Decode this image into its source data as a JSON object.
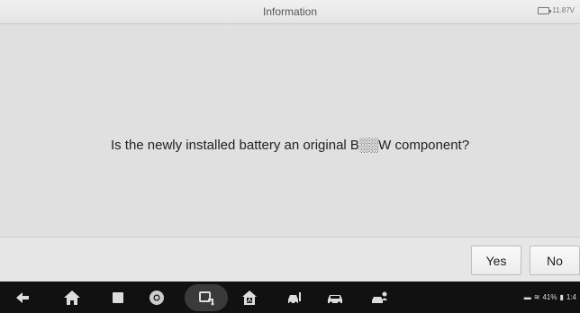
{
  "header": {
    "title": "Information",
    "battery_voltage": "11.87V"
  },
  "dialog": {
    "question": "Is the newly installed battery an original B░░W component?"
  },
  "footer": {
    "yes_label": "Yes",
    "no_label": "No"
  },
  "navbar": {
    "icons": [
      "back-icon",
      "home-icon",
      "recent-apps-icon",
      "chrome-icon",
      "vci-icon",
      "maxisys-home-icon",
      "car-service-icon",
      "car-icon",
      "car-user-icon"
    ],
    "status_text": "41%",
    "time": "1:4"
  }
}
